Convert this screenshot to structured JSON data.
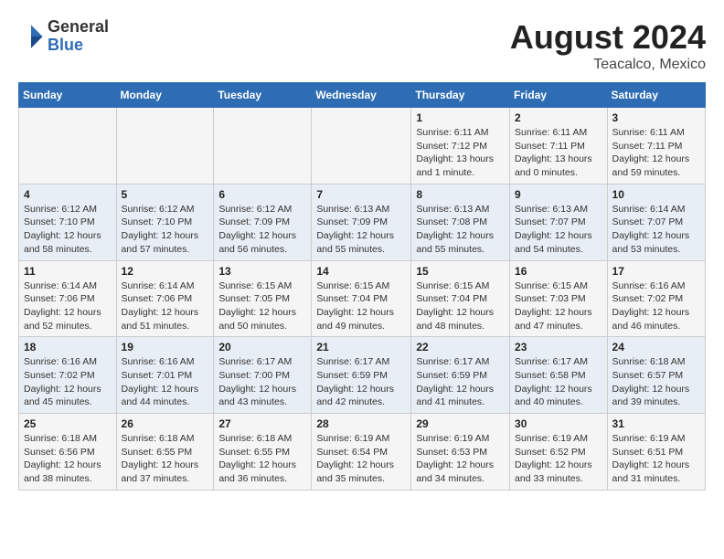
{
  "header": {
    "logo_general": "General",
    "logo_blue": "Blue",
    "title": "August 2024",
    "subtitle": "Teacalco, Mexico"
  },
  "weekdays": [
    "Sunday",
    "Monday",
    "Tuesday",
    "Wednesday",
    "Thursday",
    "Friday",
    "Saturday"
  ],
  "weeks": [
    [
      {
        "day": "",
        "text": ""
      },
      {
        "day": "",
        "text": ""
      },
      {
        "day": "",
        "text": ""
      },
      {
        "day": "",
        "text": ""
      },
      {
        "day": "1",
        "text": "Sunrise: 6:11 AM\nSunset: 7:12 PM\nDaylight: 13 hours\nand 1 minute."
      },
      {
        "day": "2",
        "text": "Sunrise: 6:11 AM\nSunset: 7:11 PM\nDaylight: 13 hours\nand 0 minutes."
      },
      {
        "day": "3",
        "text": "Sunrise: 6:11 AM\nSunset: 7:11 PM\nDaylight: 12 hours\nand 59 minutes."
      }
    ],
    [
      {
        "day": "4",
        "text": "Sunrise: 6:12 AM\nSunset: 7:10 PM\nDaylight: 12 hours\nand 58 minutes."
      },
      {
        "day": "5",
        "text": "Sunrise: 6:12 AM\nSunset: 7:10 PM\nDaylight: 12 hours\nand 57 minutes."
      },
      {
        "day": "6",
        "text": "Sunrise: 6:12 AM\nSunset: 7:09 PM\nDaylight: 12 hours\nand 56 minutes."
      },
      {
        "day": "7",
        "text": "Sunrise: 6:13 AM\nSunset: 7:09 PM\nDaylight: 12 hours\nand 55 minutes."
      },
      {
        "day": "8",
        "text": "Sunrise: 6:13 AM\nSunset: 7:08 PM\nDaylight: 12 hours\nand 55 minutes."
      },
      {
        "day": "9",
        "text": "Sunrise: 6:13 AM\nSunset: 7:07 PM\nDaylight: 12 hours\nand 54 minutes."
      },
      {
        "day": "10",
        "text": "Sunrise: 6:14 AM\nSunset: 7:07 PM\nDaylight: 12 hours\nand 53 minutes."
      }
    ],
    [
      {
        "day": "11",
        "text": "Sunrise: 6:14 AM\nSunset: 7:06 PM\nDaylight: 12 hours\nand 52 minutes."
      },
      {
        "day": "12",
        "text": "Sunrise: 6:14 AM\nSunset: 7:06 PM\nDaylight: 12 hours\nand 51 minutes."
      },
      {
        "day": "13",
        "text": "Sunrise: 6:15 AM\nSunset: 7:05 PM\nDaylight: 12 hours\nand 50 minutes."
      },
      {
        "day": "14",
        "text": "Sunrise: 6:15 AM\nSunset: 7:04 PM\nDaylight: 12 hours\nand 49 minutes."
      },
      {
        "day": "15",
        "text": "Sunrise: 6:15 AM\nSunset: 7:04 PM\nDaylight: 12 hours\nand 48 minutes."
      },
      {
        "day": "16",
        "text": "Sunrise: 6:15 AM\nSunset: 7:03 PM\nDaylight: 12 hours\nand 47 minutes."
      },
      {
        "day": "17",
        "text": "Sunrise: 6:16 AM\nSunset: 7:02 PM\nDaylight: 12 hours\nand 46 minutes."
      }
    ],
    [
      {
        "day": "18",
        "text": "Sunrise: 6:16 AM\nSunset: 7:02 PM\nDaylight: 12 hours\nand 45 minutes."
      },
      {
        "day": "19",
        "text": "Sunrise: 6:16 AM\nSunset: 7:01 PM\nDaylight: 12 hours\nand 44 minutes."
      },
      {
        "day": "20",
        "text": "Sunrise: 6:17 AM\nSunset: 7:00 PM\nDaylight: 12 hours\nand 43 minutes."
      },
      {
        "day": "21",
        "text": "Sunrise: 6:17 AM\nSunset: 6:59 PM\nDaylight: 12 hours\nand 42 minutes."
      },
      {
        "day": "22",
        "text": "Sunrise: 6:17 AM\nSunset: 6:59 PM\nDaylight: 12 hours\nand 41 minutes."
      },
      {
        "day": "23",
        "text": "Sunrise: 6:17 AM\nSunset: 6:58 PM\nDaylight: 12 hours\nand 40 minutes."
      },
      {
        "day": "24",
        "text": "Sunrise: 6:18 AM\nSunset: 6:57 PM\nDaylight: 12 hours\nand 39 minutes."
      }
    ],
    [
      {
        "day": "25",
        "text": "Sunrise: 6:18 AM\nSunset: 6:56 PM\nDaylight: 12 hours\nand 38 minutes."
      },
      {
        "day": "26",
        "text": "Sunrise: 6:18 AM\nSunset: 6:55 PM\nDaylight: 12 hours\nand 37 minutes."
      },
      {
        "day": "27",
        "text": "Sunrise: 6:18 AM\nSunset: 6:55 PM\nDaylight: 12 hours\nand 36 minutes."
      },
      {
        "day": "28",
        "text": "Sunrise: 6:19 AM\nSunset: 6:54 PM\nDaylight: 12 hours\nand 35 minutes."
      },
      {
        "day": "29",
        "text": "Sunrise: 6:19 AM\nSunset: 6:53 PM\nDaylight: 12 hours\nand 34 minutes."
      },
      {
        "day": "30",
        "text": "Sunrise: 6:19 AM\nSunset: 6:52 PM\nDaylight: 12 hours\nand 33 minutes."
      },
      {
        "day": "31",
        "text": "Sunrise: 6:19 AM\nSunset: 6:51 PM\nDaylight: 12 hours\nand 31 minutes."
      }
    ]
  ]
}
